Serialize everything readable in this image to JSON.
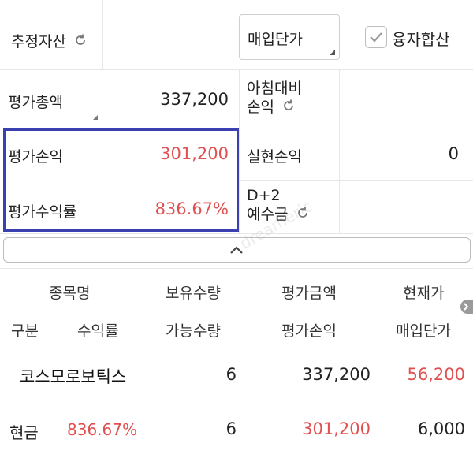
{
  "summary": {
    "estimated_assets_label": "추정자산",
    "price_select_value": "매입단가",
    "margin_sum_label": "융자합산",
    "margin_sum_checked": true,
    "total_eval_label": "평가총액",
    "total_eval_value": "337,200",
    "vs_morning_label_line1": "아침대비",
    "vs_morning_label_line2": "손익",
    "eval_pl_label": "평가손익",
    "eval_pl_value": "301,200",
    "realized_pl_label": "실현손익",
    "realized_pl_value": "0",
    "eval_return_label": "평가수익률",
    "eval_return_value": "836.67%",
    "d2_label_line1": "D+2",
    "d2_label_line2": "예수금"
  },
  "table": {
    "header_row1": [
      "종목명",
      "보유수량",
      "평가금액",
      "현재가"
    ],
    "header_row2": [
      "구분",
      "수익률",
      "가능수량",
      "평가손익",
      "매입단가"
    ],
    "rows": [
      {
        "name": "코스모로보틱스",
        "holding_qty": "6",
        "eval_amount": "337,200",
        "current_price": "56,200",
        "category": "현금",
        "return_rate": "836.67%",
        "available_qty": "6",
        "eval_pl": "301,200",
        "purchase_price": "6,000"
      }
    ]
  },
  "watermark": "dreameric",
  "colors": {
    "positive": "#e05050",
    "highlight_border": "#3b3fb0"
  },
  "icons": [
    "refresh-icon",
    "dropdown-corner-icon",
    "checkmark-icon",
    "chevron-up-icon",
    "chevron-right-icon"
  ]
}
